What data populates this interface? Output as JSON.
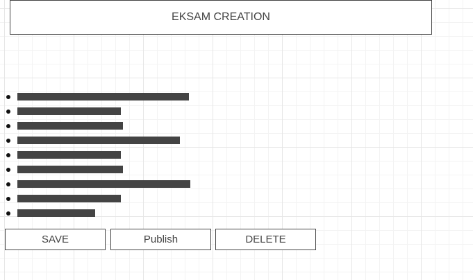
{
  "header": {
    "title": "EKSAM CREATION"
  },
  "list": {
    "items": [
      {
        "fill": 0.99
      },
      {
        "fill": 0.6
      },
      {
        "fill": 0.61
      },
      {
        "fill": 0.94
      },
      {
        "fill": 0.6
      },
      {
        "fill": 0.61
      },
      {
        "fill": 1.0
      },
      {
        "fill": 0.6
      },
      {
        "fill": 0.45
      }
    ]
  },
  "actions": {
    "save_label": "SAVE",
    "publish_label": "Publish",
    "delete_label": "DELETE"
  },
  "colors": {
    "border": "#444444",
    "bar": "#444444",
    "grid": "#e6e6e6"
  }
}
